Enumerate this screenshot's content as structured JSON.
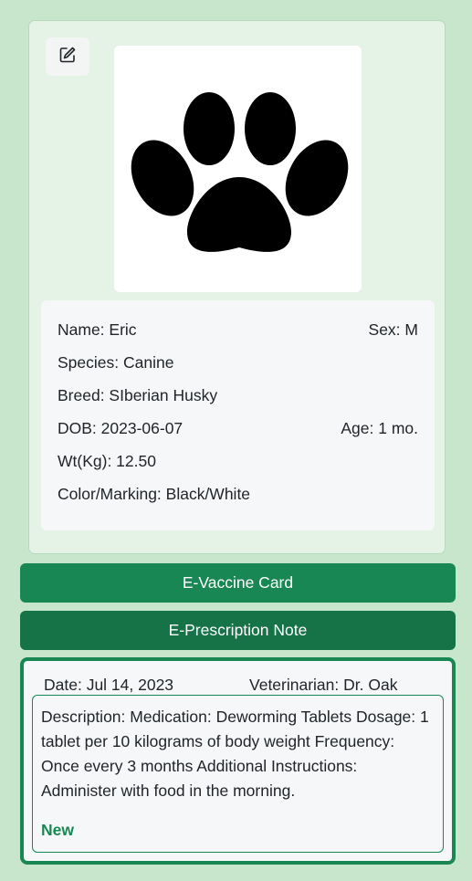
{
  "pet": {
    "name_line": "Name: Eric",
    "sex_line": "Sex: M",
    "species_line": "Species: Canine",
    "breed_line": "Breed: SIberian Husky",
    "dob_line": "DOB: 2023-06-07",
    "age_line": "Age: 1 mo.",
    "weight_line": "Wt(Kg): 12.50",
    "color_line": "Color/Marking: Black/White"
  },
  "actions": {
    "vaccine_label": "E-Vaccine Card",
    "prescription_label": "E-Prescription Note"
  },
  "prescription": {
    "date_line": "Date: Jul 14, 2023",
    "vet_line": "Veterinarian: Dr. Oak",
    "description": "Description: Medication: Deworming Tablets Dosage: 1 tablet per 10 kilograms of body weight Frequency: Once every 3 months Additional Instructions: Administer with food in the morning.",
    "status": "New"
  },
  "icons": {
    "edit": "edit-icon",
    "paw": "paw-print-icon"
  },
  "colors": {
    "page_bg": "#c8e6cc",
    "card_bg": "#e4f3e5",
    "primary_green": "#198754",
    "dark_green": "#157347"
  }
}
